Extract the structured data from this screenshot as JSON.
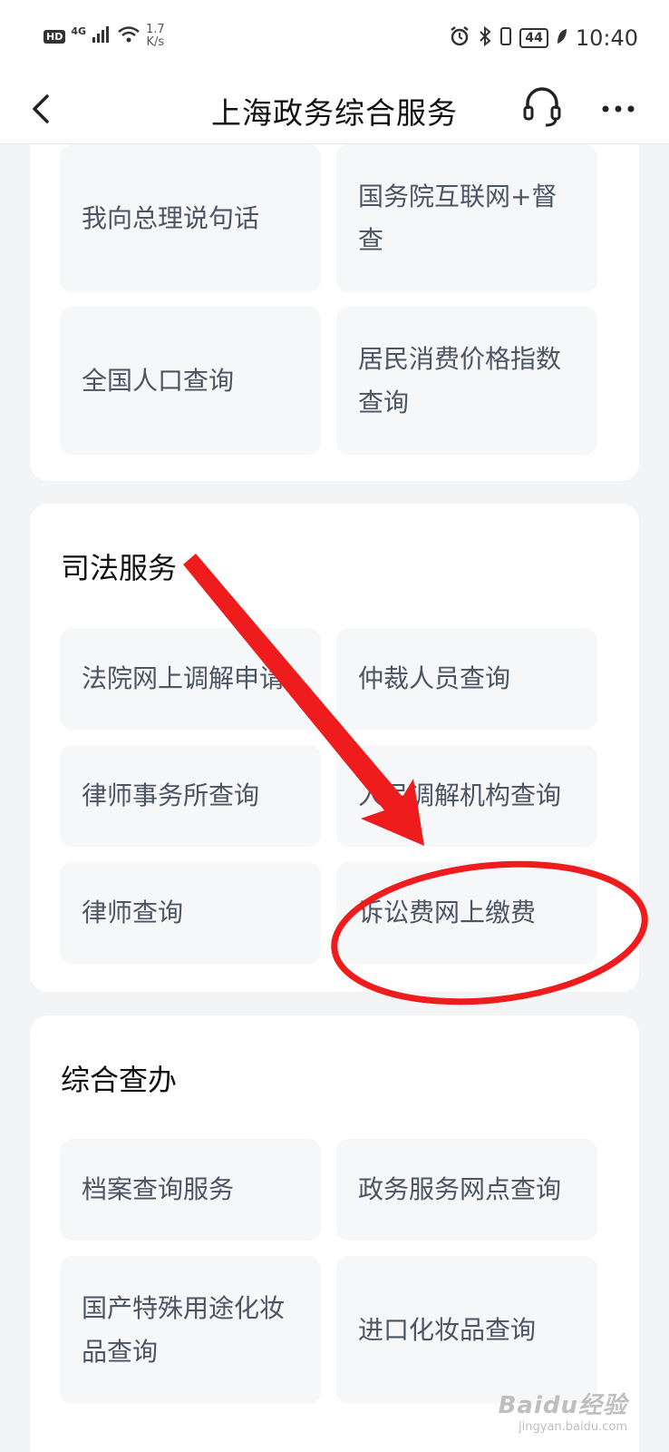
{
  "status_bar": {
    "hd": "HD",
    "network": "4G",
    "speed_value": "1.7",
    "speed_unit": "K/s",
    "battery": "44",
    "time": "10:40"
  },
  "nav": {
    "title": "上海政务综合服务",
    "back_icon": "chevron-left-icon",
    "service_icon": "headset-icon",
    "more_icon": "more-dots-icon"
  },
  "sections": {
    "top": {
      "items": [
        "我向总理说句话",
        "国务院互联网+督查",
        "全国人口查询",
        "居民消费价格指数查询"
      ]
    },
    "judicial": {
      "title": "司法服务",
      "items": [
        "法院网上调解申请",
        "仲裁人员查询",
        "律师事务所查询",
        "人民调解机构查询",
        "律师查询",
        "诉讼费网上缴费"
      ]
    },
    "general": {
      "title": "综合查办",
      "items": [
        "档案查询服务",
        "政务服务网点查询",
        "国产特殊用途化妆品查询",
        "进口化妆品查询"
      ]
    }
  },
  "annotation": {
    "color": "#ee1c1c"
  },
  "watermark": {
    "brand": "Baidu经验",
    "site": "jingyan.baidu.com"
  }
}
